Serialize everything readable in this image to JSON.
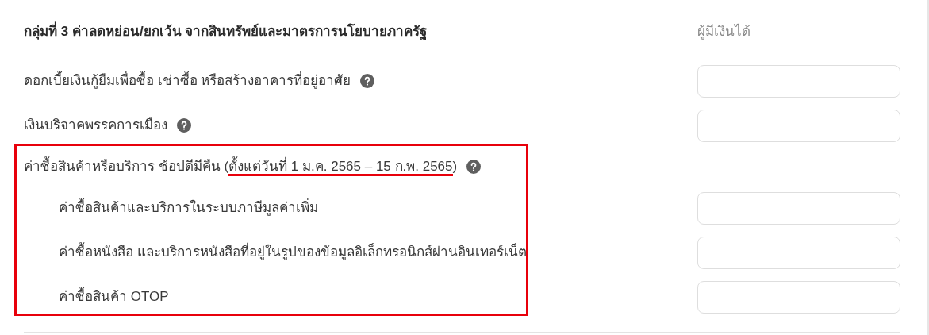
{
  "section": {
    "title": "กลุ่มที่ 3 ค่าลดหย่อน/ยกเว้น จากสินทรัพย์และมาตรการนโยบายภาครัฐ",
    "column_heading": "ผู้มีเงินได้"
  },
  "rows": [
    {
      "kind": "field",
      "label": "ดอกเบี้ยเงินกู้ยืมเพื่อซื้อ เช่าซื้อ หรือสร้างอาคารที่อยู่อาศัย",
      "help": true
    },
    {
      "kind": "field",
      "label": "เงินบริจาคพรรคการเมือง",
      "help": true
    },
    {
      "kind": "group",
      "label_before": "ค่าซื้อสินค้าหรือบริการ ช้อปดีมีคืน (",
      "label_underlined": "ตั้งแต่วันที่ 1 ม.ค. 2565 – 15 ก.พ. 2565",
      "label_after": ")",
      "help": true,
      "highlighted": true,
      "children": [
        {
          "kind": "field",
          "label": "ค่าซื้อสินค้าและบริการในระบบภาษีมูลค่าเพิ่ม"
        },
        {
          "kind": "field",
          "label": "ค่าซื้อหนังสือ และบริการหนังสือที่อยู่ในรูปของข้อมูลอิเล็กทรอนิกส์ผ่านอินเทอร์เน็ต"
        },
        {
          "kind": "field",
          "label": "ค่าซื้อสินค้า OTOP"
        }
      ]
    }
  ]
}
